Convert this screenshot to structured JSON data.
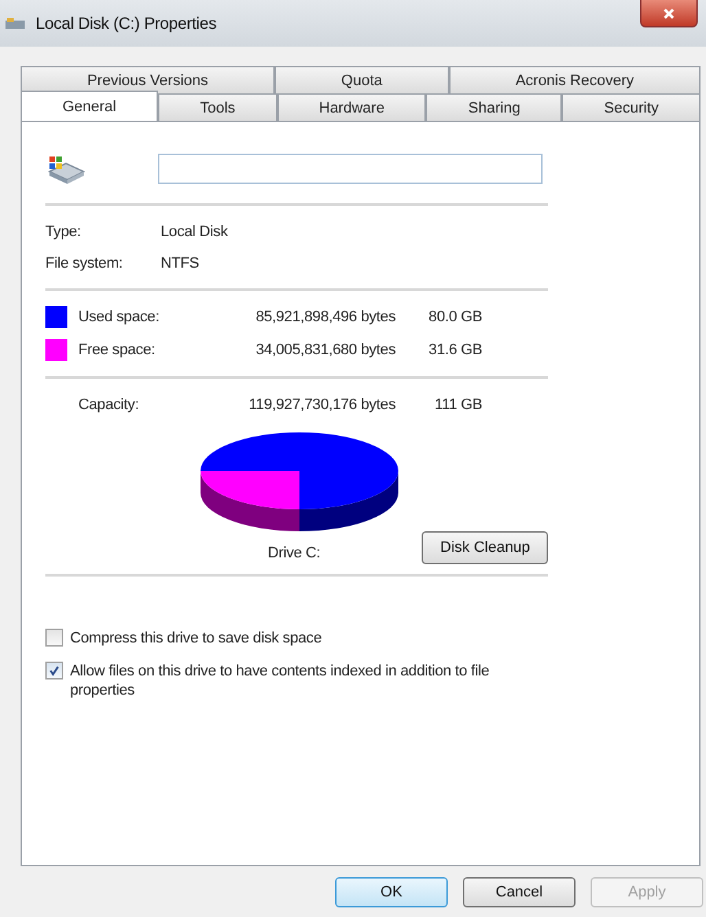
{
  "window": {
    "title": "Local Disk (C:) Properties"
  },
  "tab_rows": [
    [
      {
        "label": "Previous Versions",
        "selected": false
      },
      {
        "label": "Quota",
        "selected": false
      },
      {
        "label": "Acronis Recovery",
        "selected": false
      }
    ],
    [
      {
        "label": "General",
        "selected": true
      },
      {
        "label": "Tools",
        "selected": false
      },
      {
        "label": "Hardware",
        "selected": false
      },
      {
        "label": "Sharing",
        "selected": false
      },
      {
        "label": "Security",
        "selected": false
      }
    ]
  ],
  "info": [
    {
      "label": "Type:",
      "value": "Local Disk"
    },
    {
      "label": "File system:",
      "value": "NTFS"
    }
  ],
  "space": [
    {
      "label": "Used space:",
      "bytes": "85,921,898,496 bytes",
      "size": "80.0 GB",
      "color": "#0000ff"
    },
    {
      "label": "Free space:",
      "bytes": "34,005,831,680 bytes",
      "size": "31.6 GB",
      "color": "#ff00ff"
    }
  ],
  "capacity": {
    "label": "Capacity:",
    "bytes": "119,927,730,176 bytes",
    "size": "111 GB"
  },
  "drive_label": "Drive C:",
  "cleanup_button": "Disk Cleanup",
  "options": [
    {
      "label": "Compress this drive to save disk space",
      "checked": false
    },
    {
      "label": "Allow files on this drive to have contents indexed in addition to file properties",
      "checked": true
    }
  ],
  "buttons": [
    {
      "label": "OK",
      "kind": "default"
    },
    {
      "label": "Cancel",
      "kind": "normal"
    },
    {
      "label": "Apply",
      "kind": "disabled"
    }
  ]
}
